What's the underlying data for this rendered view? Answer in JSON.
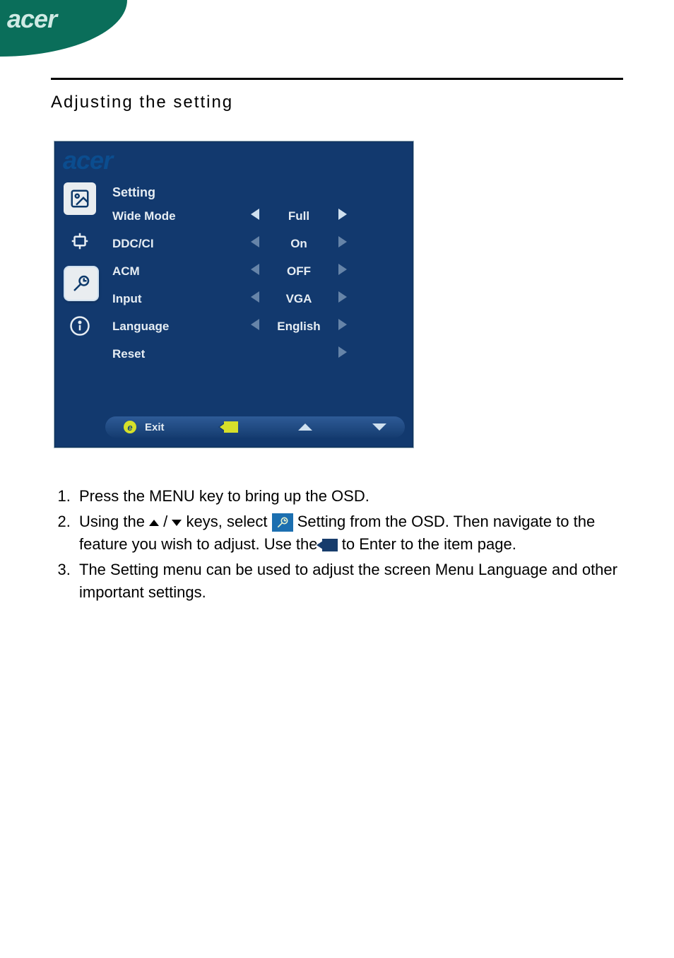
{
  "brand": "acer",
  "page_title": "Adjusting the setting",
  "osd": {
    "brand": "acer",
    "heading": "Setting",
    "rows": [
      {
        "label": "Wide Mode",
        "value": "Full",
        "left": true,
        "right": true
      },
      {
        "label": "DDC/CI",
        "value": "On",
        "left": true,
        "right": true,
        "dim": true
      },
      {
        "label": "ACM",
        "value": "OFF",
        "left": true,
        "right": true,
        "dim": true
      },
      {
        "label": "Input",
        "value": "VGA",
        "left": true,
        "right": true,
        "dim": true
      },
      {
        "label": "Language",
        "value": "English",
        "left": true,
        "right": true,
        "dim": true
      },
      {
        "label": "Reset",
        "value": "",
        "left": false,
        "right": true,
        "dim": true
      }
    ],
    "bar": {
      "exit": "Exit"
    }
  },
  "steps": {
    "s1": "Press the MENU key to bring up the OSD.",
    "s2a": "Using the ",
    "s2b": " / ",
    "s2c": " keys, select ",
    "s2d": " Setting from the OSD. Then navigate to the feature you wish to adjust. Use the ",
    "s2e": " to Enter to the item page.",
    "s3": "The Setting menu can be used to adjust the screen Menu Language and other important settings."
  }
}
